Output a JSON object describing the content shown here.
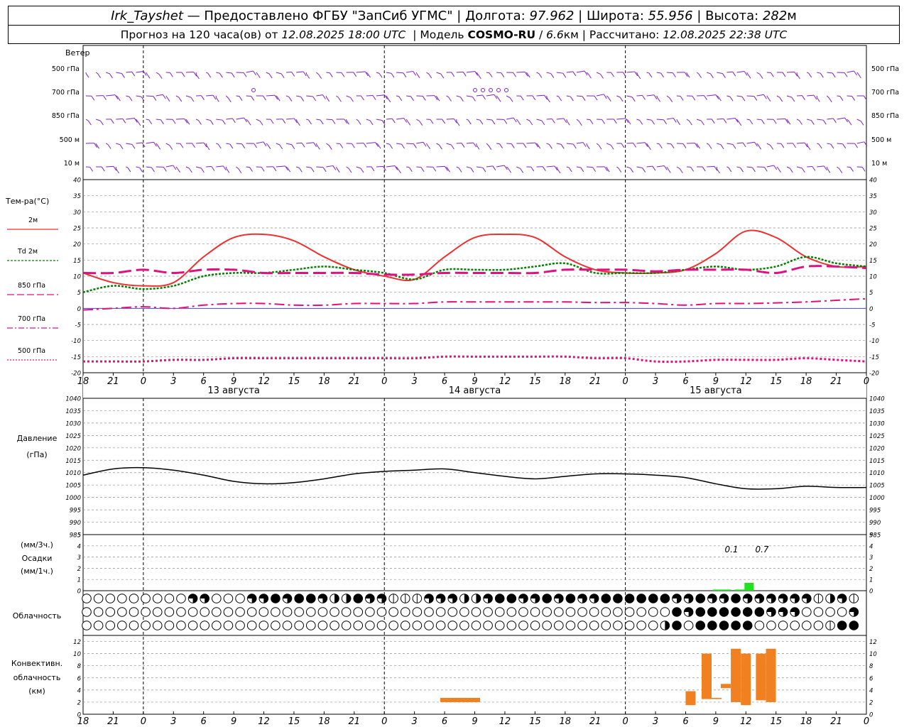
{
  "header": {
    "station": "Irk_Tayshet",
    "provider": "— Предоставлено ФГБУ \"ЗапСиб УГМС\"",
    "lon_label": "Долгота:",
    "lon": "97.962",
    "lat_label": "Широта:",
    "lat": "55.956",
    "alt_label": "Высота:",
    "alt": "282",
    "alt_unit": "м",
    "forecast_prefix": "Прогноз на 120 часа(ов) от",
    "forecast_from": "12.08.2025 18:00 UTC",
    "model_label": "Модель",
    "model_name": "COSMO-RU",
    "model_res": "6.6",
    "model_res_unit": "км",
    "calc_label": "Рассчитано:",
    "calc_time": "12.08.2025 22:38 UTC"
  },
  "colors": {
    "wind": "#8020c0",
    "t2m": "#f03030",
    "td2m": "#008000",
    "t850": "#e01080",
    "t700": "#e01080",
    "t500": "#e01080",
    "pressure": "#000000",
    "precip": "#20e020",
    "convective": "#f08020",
    "grid": "#909090"
  },
  "time_axis": {
    "tick_labels": [
      "18",
      "21",
      "0",
      "3",
      "6",
      "9",
      "12",
      "15",
      "18",
      "21",
      "0",
      "3",
      "6",
      "9",
      "12",
      "15",
      "18",
      "21",
      "0",
      "3",
      "6",
      "9",
      "12",
      "15",
      "18",
      "21",
      "0"
    ],
    "day_labels": [
      "13 августа",
      "14 августа",
      "15 августа"
    ]
  },
  "chart_data": [
    {
      "type": "barbs",
      "title": "Ветер",
      "levels": [
        "500 гПа",
        "700 гПа",
        "850 гПа",
        "500 м",
        "10 м"
      ]
    },
    {
      "type": "line",
      "ylabel": "Тем-ра(°C)",
      "ylim": [
        -20,
        40
      ],
      "yticks": [
        -20,
        -15,
        -10,
        -5,
        0,
        5,
        10,
        15,
        20,
        25,
        30,
        35,
        40
      ],
      "legend": [
        "2м",
        "Td 2м",
        "850 гПа",
        "700 гПа",
        "500 гПа"
      ],
      "x_hours": [
        0,
        3,
        6,
        9,
        12,
        15,
        18,
        21,
        24,
        27,
        30,
        33,
        36,
        39,
        42,
        45,
        48,
        51,
        54,
        57,
        60,
        63,
        66,
        69,
        72,
        75,
        78
      ],
      "series": [
        {
          "name": "2м",
          "values": [
            11,
            8,
            7,
            8,
            16,
            22,
            23,
            21,
            16,
            12,
            10,
            9,
            16,
            22,
            23,
            22,
            16,
            12,
            11,
            11,
            12,
            17,
            24,
            22,
            16,
            13,
            13
          ]
        },
        {
          "name": "Td 2м",
          "values": [
            5,
            7,
            6,
            7,
            10,
            11,
            11,
            12,
            13,
            12,
            11,
            9,
            12,
            12,
            12,
            13,
            14,
            11,
            11,
            11,
            12,
            13,
            12,
            13,
            16,
            14,
            13
          ]
        },
        {
          "name": "850 гПа",
          "values": [
            11,
            11,
            12,
            11,
            12,
            12,
            11,
            11,
            11,
            11,
            10.5,
            10.5,
            11,
            11,
            11,
            11,
            12,
            12,
            12,
            11.5,
            12,
            12,
            12,
            11,
            13,
            13,
            12.5
          ]
        },
        {
          "name": "700 гПа",
          "values": [
            -0.5,
            0,
            0.5,
            0,
            1,
            1.5,
            1.5,
            1,
            1,
            1.5,
            1.5,
            1.5,
            2,
            2,
            2,
            2,
            2,
            1.8,
            1.8,
            1.5,
            1,
            1.5,
            1.5,
            1.7,
            2,
            2.5,
            3
          ]
        },
        {
          "name": "500 гПа",
          "values": [
            -16.5,
            -16.5,
            -16.5,
            -16,
            -16,
            -15.5,
            -15.5,
            -15.5,
            -15.5,
            -15.5,
            -15.5,
            -15.5,
            -15,
            -15,
            -15,
            -15,
            -15,
            -15.5,
            -15.5,
            -16.5,
            -16.5,
            -16,
            -16,
            -16,
            -15.5,
            -16,
            -16.5
          ]
        }
      ]
    },
    {
      "type": "line",
      "ylabel": "Давление",
      "yunit": "(гПа)",
      "ylim": [
        985,
        1040
      ],
      "yticks": [
        985,
        990,
        995,
        1000,
        1005,
        1010,
        1015,
        1020,
        1025,
        1030,
        1035,
        1040
      ],
      "series": [
        {
          "name": "Давление",
          "values": [
            1009,
            1011.5,
            1012,
            1011,
            1009,
            1006.5,
            1005.5,
            1006,
            1007.5,
            1009.5,
            1010.5,
            1011,
            1011.5,
            1010,
            1008.5,
            1007.5,
            1008.5,
            1009.5,
            1009.5,
            1009,
            1008,
            1005.5,
            1003.5,
            1003.5,
            1004.5,
            1004,
            1004
          ]
        }
      ]
    },
    {
      "type": "bar",
      "ylabel": "Осадки",
      "unit_top": "(мм/3ч.)",
      "unit_bottom": "(мм/1ч.)",
      "ylim": [
        0,
        5
      ],
      "yticks": [
        0,
        1,
        2,
        3,
        4,
        5
      ],
      "bars": [
        {
          "x_hours": 63,
          "value": 0.1
        },
        {
          "x_hours": 66,
          "value": 0.7
        }
      ],
      "annotations": [
        "0.1",
        "0.7"
      ]
    },
    {
      "type": "table",
      "ylabel": "Облачность",
      "rows": 3,
      "cols": 66,
      "legend": "cloud cover symbols: empty circle = clear, filled circle = overcast"
    },
    {
      "type": "bar",
      "ylabel": "Конвективн. облачность (км)",
      "ylim": [
        0,
        13
      ],
      "yticks": [
        0,
        2,
        4,
        6,
        8,
        10,
        12
      ],
      "bars": [
        {
          "x_hours": 34.5,
          "bottom": 2.0,
          "top": 2.7
        },
        {
          "x_hours": 36.5,
          "bottom": 2.0,
          "top": 2.7
        },
        {
          "x_hours": 60,
          "bottom": 1.5,
          "top": 3.8
        },
        {
          "x_hours": 61,
          "bottom": 2.5,
          "top": 10.0
        },
        {
          "x_hours": 62,
          "bottom": 2.5,
          "top": 2.7
        },
        {
          "x_hours": 63.5,
          "bottom": 4.3,
          "top": 5.0
        },
        {
          "x_hours": 64.5,
          "bottom": 2.0,
          "top": 10.8
        },
        {
          "x_hours": 65.5,
          "bottom": 1.5,
          "top": 10.0
        },
        {
          "x_hours": 67,
          "bottom": 2.3,
          "top": 10.0
        },
        {
          "x_hours": 68,
          "bottom": 2.0,
          "top": 10.8
        }
      ]
    }
  ]
}
